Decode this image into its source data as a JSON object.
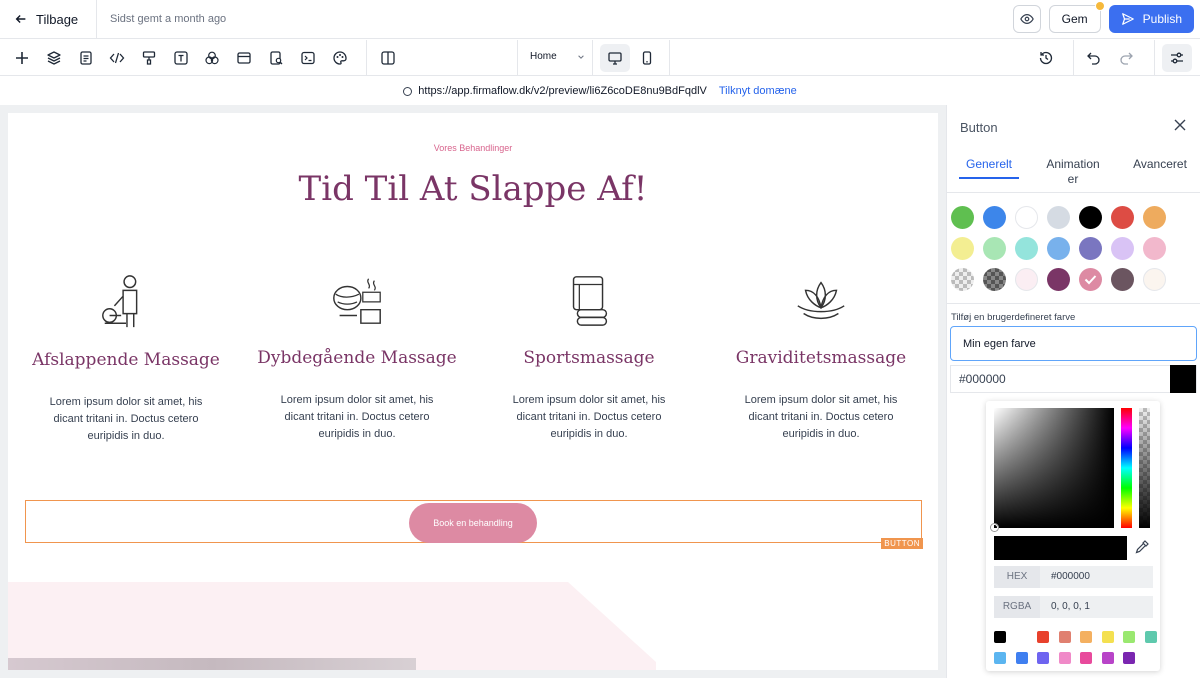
{
  "topbar": {
    "back_label": "Tilbage",
    "saved_status": "Sidst gemt a month ago",
    "save_label": "Gem",
    "publish_label": "Publish"
  },
  "toolbar": {
    "page_select": "Home",
    "tools": [
      "plus-icon",
      "layers-icon",
      "page-icon",
      "code-icon",
      "paint-roller-icon",
      "text-icon",
      "circles-icon",
      "layout-icon",
      "seo-search-icon",
      "terminal-icon",
      "palette-icon",
      "split-view-icon"
    ]
  },
  "urlbar": {
    "url": "https://app.firmaflow.dk/v2/preview/li6Z6coDE8nu9BdFqdlV",
    "link_label": "Tilknyt domæne"
  },
  "canvas": {
    "eyebrow": "Vores Behandlinger",
    "headline": "Tid Til At Slappe Af!",
    "services": [
      {
        "title": "Afslappende Massage",
        "text": "Lorem ipsum dolor sit amet, his dicant tritani in. Doctus cetero euripidis in duo.",
        "icon": "massage-person-icon"
      },
      {
        "title": "Dybdegående Massage",
        "text": "Lorem ipsum dolor sit amet, his dicant tritani in. Doctus cetero euripidis in duo.",
        "icon": "hot-stone-icon"
      },
      {
        "title": "Sportsmassage",
        "text": "Lorem ipsum dolor sit amet, his dicant tritani in. Doctus cetero euripidis in duo.",
        "icon": "towels-icon"
      },
      {
        "title": "Graviditetsmassage",
        "text": "Lorem ipsum dolor sit amet, his dicant tritani in. Doctus cetero euripidis in duo.",
        "icon": "lotus-icon"
      }
    ],
    "button_label": "Book en behandling",
    "selection_tag": "BUTTON"
  },
  "panel": {
    "title": "Button",
    "tabs": [
      "Generelt",
      "Animation er",
      "Avanceret"
    ],
    "active_tab": "Generelt",
    "swatches": [
      "#5fbf50",
      "#3d86ea",
      "#ffffff",
      "#d5dbe3",
      "#000000",
      "#dd4c44",
      "#eeab5e",
      "#f3ee92",
      "#a8e6b4",
      "#94e4dc",
      "#78b1ec",
      "#7a76c0",
      "#d9c3f5",
      "#f2b8cc",
      "transparent",
      "checker-dark",
      "#fbeef3",
      "#7a3566",
      "#dd8aa3",
      "#6b5560",
      "#fbf5ef"
    ],
    "selected_swatch": "#dd8aa3",
    "custom_label": "Tilføj en brugerdefineret farve",
    "custom_value": "Min egen farve",
    "hex_value": "#000000",
    "picker": {
      "hex_label": "HEX",
      "hex_value": "#000000",
      "rgba_label": "RGBA",
      "rgba_value": "0, 0, 0, 1",
      "presets": [
        "#000000",
        "#ffffff",
        "#e8412c",
        "#e08070",
        "#f4b060",
        "#f4e050",
        "#9ae870",
        "#5ec9ad",
        "#5bb5f0",
        "#3f7ff0",
        "#6e64f0",
        "#f08ac8",
        "#e84a9c",
        "#b844c8",
        "#7a26b0",
        "#ffffff"
      ]
    }
  }
}
